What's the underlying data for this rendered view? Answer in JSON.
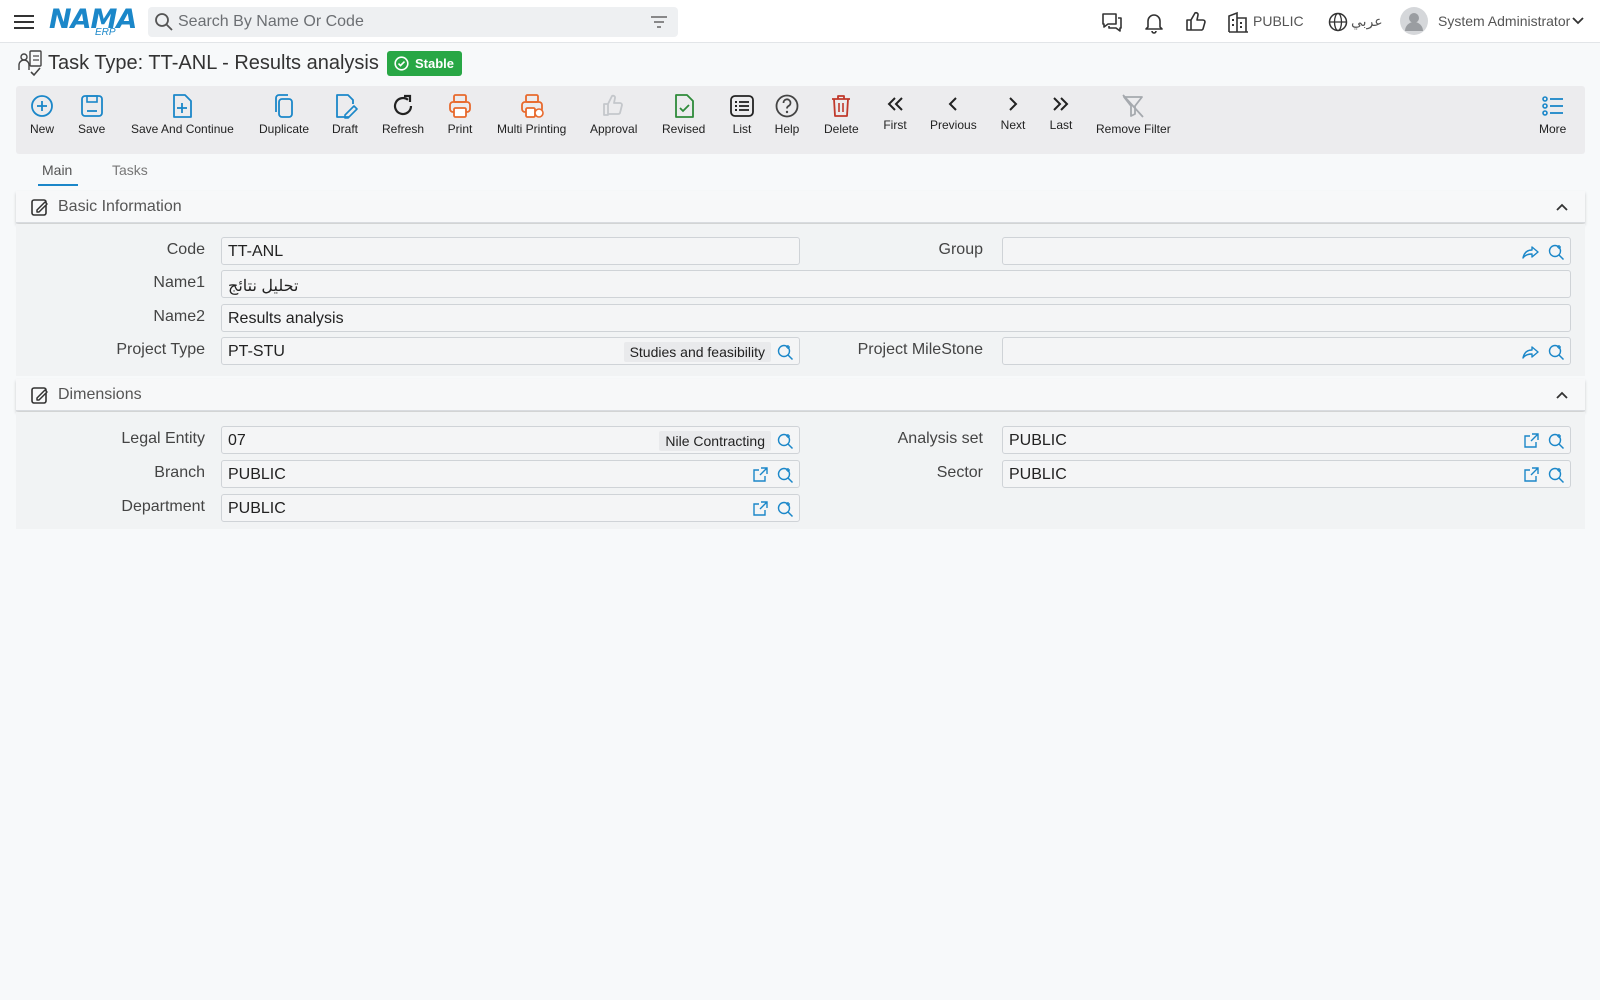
{
  "header": {
    "logo_text": "NAMA",
    "logo_sub": "ERP",
    "search_placeholder": "Search By Name Or Code",
    "company": "PUBLIC",
    "language": "عربي",
    "user": "System Administrator"
  },
  "page": {
    "title": "Task Type: TT-ANL - Results analysis",
    "status": "Stable"
  },
  "toolbar": {
    "new": "New",
    "save": "Save",
    "save_continue": "Save And Continue",
    "duplicate": "Duplicate",
    "draft": "Draft",
    "refresh": "Refresh",
    "print": "Print",
    "multi_printing": "Multi Printing",
    "approval": "Approval",
    "revised": "Revised",
    "list": "List",
    "help": "Help",
    "delete": "Delete",
    "first": "First",
    "previous": "Previous",
    "next": "Next",
    "last": "Last",
    "remove_filter": "Remove Filter",
    "more": "More"
  },
  "tabs": {
    "main": "Main",
    "tasks": "Tasks"
  },
  "basic": {
    "title": "Basic Information",
    "code_label": "Code",
    "code_value": "TT-ANL",
    "group_label": "Group",
    "group_value": "",
    "name1_label": "Name1",
    "name1_value": "تحليل نتائج",
    "name2_label": "Name2",
    "name2_value": "Results analysis",
    "project_type_label": "Project Type",
    "project_type_value": "PT-STU",
    "project_type_desc": "Studies and feasibility",
    "milestone_label": "Project MileStone",
    "milestone_value": ""
  },
  "dimensions": {
    "title": "Dimensions",
    "legal_entity_label": "Legal Entity",
    "legal_entity_value": "07",
    "legal_entity_desc": "Nile Contracting",
    "analysis_set_label": "Analysis set",
    "analysis_set_value": "PUBLIC",
    "branch_label": "Branch",
    "branch_value": "PUBLIC",
    "sector_label": "Sector",
    "sector_value": "PUBLIC",
    "department_label": "Department",
    "department_value": "PUBLIC"
  },
  "colors": {
    "accent": "#1b87c9",
    "print_orange": "#e8692c",
    "delete_red": "#c0392b",
    "revised_green": "#2e8b3a",
    "stable_green": "#28a745"
  }
}
